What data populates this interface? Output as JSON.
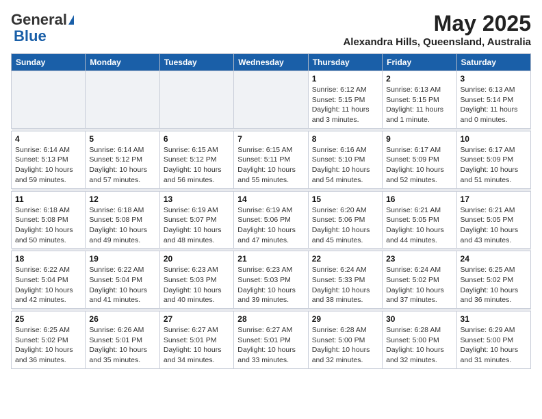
{
  "header": {
    "logo_general": "General",
    "logo_blue": "Blue",
    "title": "May 2025",
    "subtitle": "Alexandra Hills, Queensland, Australia"
  },
  "days_of_week": [
    "Sunday",
    "Monday",
    "Tuesday",
    "Wednesday",
    "Thursday",
    "Friday",
    "Saturday"
  ],
  "weeks": [
    [
      {
        "day": "",
        "info": ""
      },
      {
        "day": "",
        "info": ""
      },
      {
        "day": "",
        "info": ""
      },
      {
        "day": "",
        "info": ""
      },
      {
        "day": "1",
        "info": "Sunrise: 6:12 AM\nSunset: 5:15 PM\nDaylight: 11 hours\nand 3 minutes."
      },
      {
        "day": "2",
        "info": "Sunrise: 6:13 AM\nSunset: 5:15 PM\nDaylight: 11 hours\nand 1 minute."
      },
      {
        "day": "3",
        "info": "Sunrise: 6:13 AM\nSunset: 5:14 PM\nDaylight: 11 hours\nand 0 minutes."
      }
    ],
    [
      {
        "day": "4",
        "info": "Sunrise: 6:14 AM\nSunset: 5:13 PM\nDaylight: 10 hours\nand 59 minutes."
      },
      {
        "day": "5",
        "info": "Sunrise: 6:14 AM\nSunset: 5:12 PM\nDaylight: 10 hours\nand 57 minutes."
      },
      {
        "day": "6",
        "info": "Sunrise: 6:15 AM\nSunset: 5:12 PM\nDaylight: 10 hours\nand 56 minutes."
      },
      {
        "day": "7",
        "info": "Sunrise: 6:15 AM\nSunset: 5:11 PM\nDaylight: 10 hours\nand 55 minutes."
      },
      {
        "day": "8",
        "info": "Sunrise: 6:16 AM\nSunset: 5:10 PM\nDaylight: 10 hours\nand 54 minutes."
      },
      {
        "day": "9",
        "info": "Sunrise: 6:17 AM\nSunset: 5:09 PM\nDaylight: 10 hours\nand 52 minutes."
      },
      {
        "day": "10",
        "info": "Sunrise: 6:17 AM\nSunset: 5:09 PM\nDaylight: 10 hours\nand 51 minutes."
      }
    ],
    [
      {
        "day": "11",
        "info": "Sunrise: 6:18 AM\nSunset: 5:08 PM\nDaylight: 10 hours\nand 50 minutes."
      },
      {
        "day": "12",
        "info": "Sunrise: 6:18 AM\nSunset: 5:08 PM\nDaylight: 10 hours\nand 49 minutes."
      },
      {
        "day": "13",
        "info": "Sunrise: 6:19 AM\nSunset: 5:07 PM\nDaylight: 10 hours\nand 48 minutes."
      },
      {
        "day": "14",
        "info": "Sunrise: 6:19 AM\nSunset: 5:06 PM\nDaylight: 10 hours\nand 47 minutes."
      },
      {
        "day": "15",
        "info": "Sunrise: 6:20 AM\nSunset: 5:06 PM\nDaylight: 10 hours\nand 45 minutes."
      },
      {
        "day": "16",
        "info": "Sunrise: 6:21 AM\nSunset: 5:05 PM\nDaylight: 10 hours\nand 44 minutes."
      },
      {
        "day": "17",
        "info": "Sunrise: 6:21 AM\nSunset: 5:05 PM\nDaylight: 10 hours\nand 43 minutes."
      }
    ],
    [
      {
        "day": "18",
        "info": "Sunrise: 6:22 AM\nSunset: 5:04 PM\nDaylight: 10 hours\nand 42 minutes."
      },
      {
        "day": "19",
        "info": "Sunrise: 6:22 AM\nSunset: 5:04 PM\nDaylight: 10 hours\nand 41 minutes."
      },
      {
        "day": "20",
        "info": "Sunrise: 6:23 AM\nSunset: 5:03 PM\nDaylight: 10 hours\nand 40 minutes."
      },
      {
        "day": "21",
        "info": "Sunrise: 6:23 AM\nSunset: 5:03 PM\nDaylight: 10 hours\nand 39 minutes."
      },
      {
        "day": "22",
        "info": "Sunrise: 6:24 AM\nSunset: 5:33 PM\nDaylight: 10 hours\nand 38 minutes."
      },
      {
        "day": "23",
        "info": "Sunrise: 6:24 AM\nSunset: 5:02 PM\nDaylight: 10 hours\nand 37 minutes."
      },
      {
        "day": "24",
        "info": "Sunrise: 6:25 AM\nSunset: 5:02 PM\nDaylight: 10 hours\nand 36 minutes."
      }
    ],
    [
      {
        "day": "25",
        "info": "Sunrise: 6:25 AM\nSunset: 5:02 PM\nDaylight: 10 hours\nand 36 minutes."
      },
      {
        "day": "26",
        "info": "Sunrise: 6:26 AM\nSunset: 5:01 PM\nDaylight: 10 hours\nand 35 minutes."
      },
      {
        "day": "27",
        "info": "Sunrise: 6:27 AM\nSunset: 5:01 PM\nDaylight: 10 hours\nand 34 minutes."
      },
      {
        "day": "28",
        "info": "Sunrise: 6:27 AM\nSunset: 5:01 PM\nDaylight: 10 hours\nand 33 minutes."
      },
      {
        "day": "29",
        "info": "Sunrise: 6:28 AM\nSunset: 5:00 PM\nDaylight: 10 hours\nand 32 minutes."
      },
      {
        "day": "30",
        "info": "Sunrise: 6:28 AM\nSunset: 5:00 PM\nDaylight: 10 hours\nand 32 minutes."
      },
      {
        "day": "31",
        "info": "Sunrise: 6:29 AM\nSunset: 5:00 PM\nDaylight: 10 hours\nand 31 minutes."
      }
    ]
  ]
}
